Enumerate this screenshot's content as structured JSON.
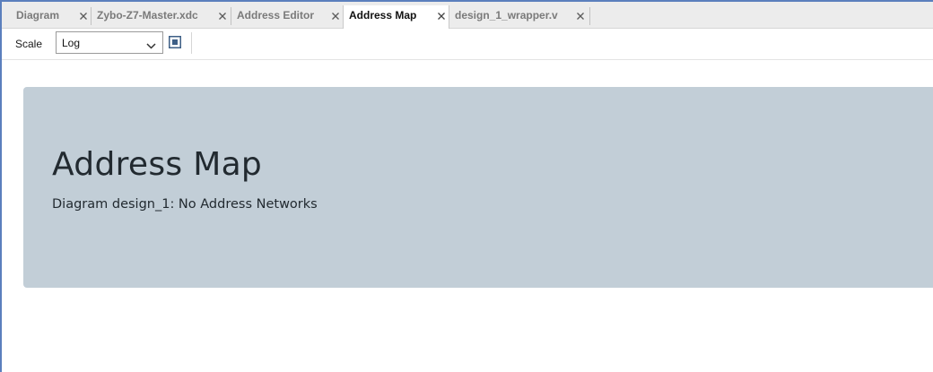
{
  "tabs": [
    {
      "label": "Diagram",
      "active": false
    },
    {
      "label": "Zybo-Z7-Master.xdc",
      "active": false
    },
    {
      "label": "Address Editor",
      "active": false
    },
    {
      "label": "Address Map",
      "active": true
    },
    {
      "label": "design_1_wrapper.v",
      "active": false
    }
  ],
  "toolbar": {
    "scale_label": "Scale",
    "scale_value": "Log",
    "fit_icon": "fit-to-window-icon"
  },
  "panel": {
    "title": "Address Map",
    "subtitle": "Diagram design_1: No Address Networks"
  },
  "colors": {
    "window_border": "#5b7fbd",
    "panel_background": "#c2ced7",
    "active_tab_text": "#111111",
    "inactive_tab_text": "#7a7a7a"
  }
}
